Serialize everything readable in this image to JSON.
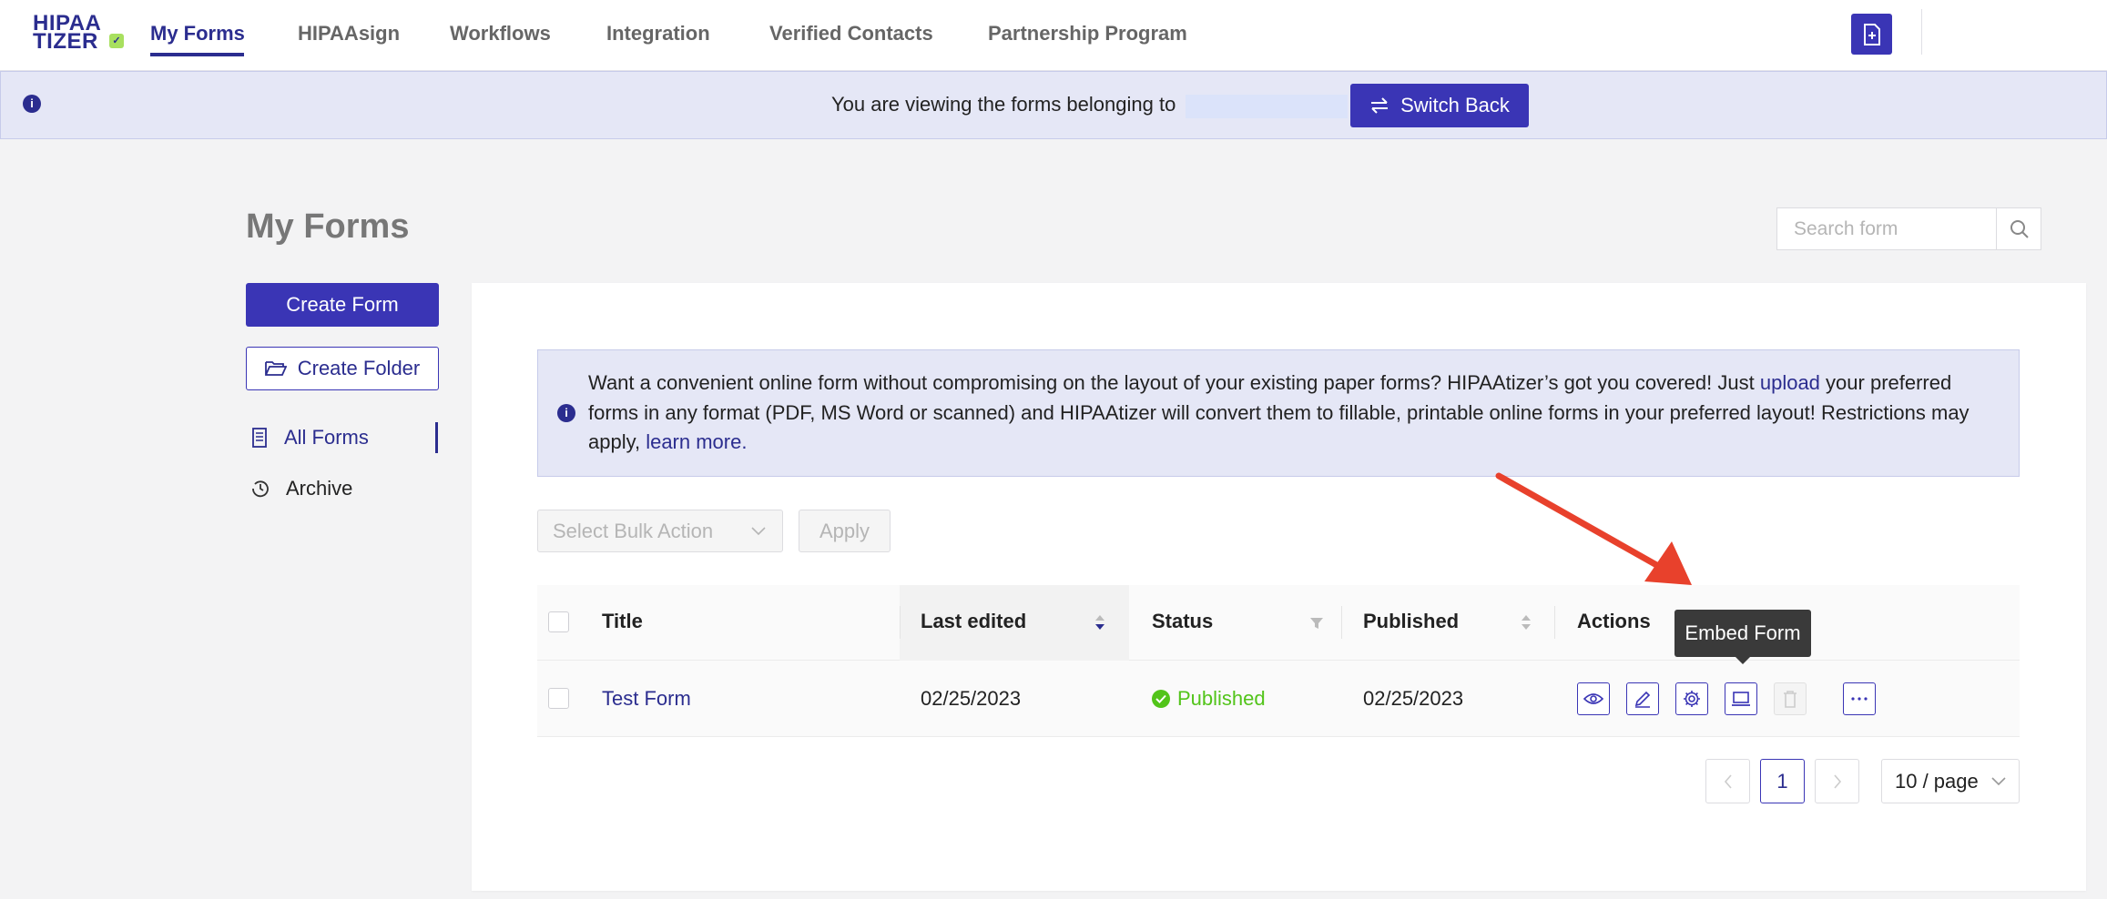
{
  "logo": {
    "line1": "HIPAA",
    "line2": "TIZER"
  },
  "nav": {
    "items": [
      {
        "label": "My Forms",
        "active": true
      },
      {
        "label": "HIPAAsign"
      },
      {
        "label": "Workflows"
      },
      {
        "label": "Integration"
      },
      {
        "label": "Verified Contacts"
      },
      {
        "label": "Partnership Program"
      }
    ]
  },
  "banner": {
    "text": "You are viewing the forms belonging to",
    "switch_label": "Switch Back"
  },
  "page": {
    "title": "My Forms",
    "search_placeholder": "Search form"
  },
  "sidebar": {
    "create_form": "Create Form",
    "create_folder": "Create Folder",
    "items": [
      {
        "label": "All Forms",
        "active": true
      },
      {
        "label": "Archive"
      }
    ]
  },
  "notice": {
    "line1_a": "Want a convenient online form without compromising on the layout of your existing paper forms? HIPAAtizer’s got you covered! Just",
    "upload_link": "upload",
    "line1_b": "your preferred",
    "line2": "forms in any format (PDF, MS Word or scanned) and HIPAAtizer will convert them to fillable, printable online forms in your preferred layout! Restrictions may",
    "line3_a": "apply,",
    "learn_more": "learn more."
  },
  "bulk": {
    "select_placeholder": "Select Bulk Action",
    "apply_label": "Apply"
  },
  "table": {
    "columns": [
      "Title",
      "Last edited",
      "Status",
      "Published",
      "Actions"
    ],
    "rows": [
      {
        "title": "Test Form",
        "last_edited": "02/25/2023",
        "status": "Published",
        "published": "02/25/2023"
      }
    ]
  },
  "tooltip": {
    "text": "Embed Form"
  },
  "pagination": {
    "current_page": "1",
    "page_size": "10 / page"
  },
  "colors": {
    "brand": "#3a35b5",
    "status_published": "#52c41a",
    "annotation_arrow": "#e8412c"
  }
}
